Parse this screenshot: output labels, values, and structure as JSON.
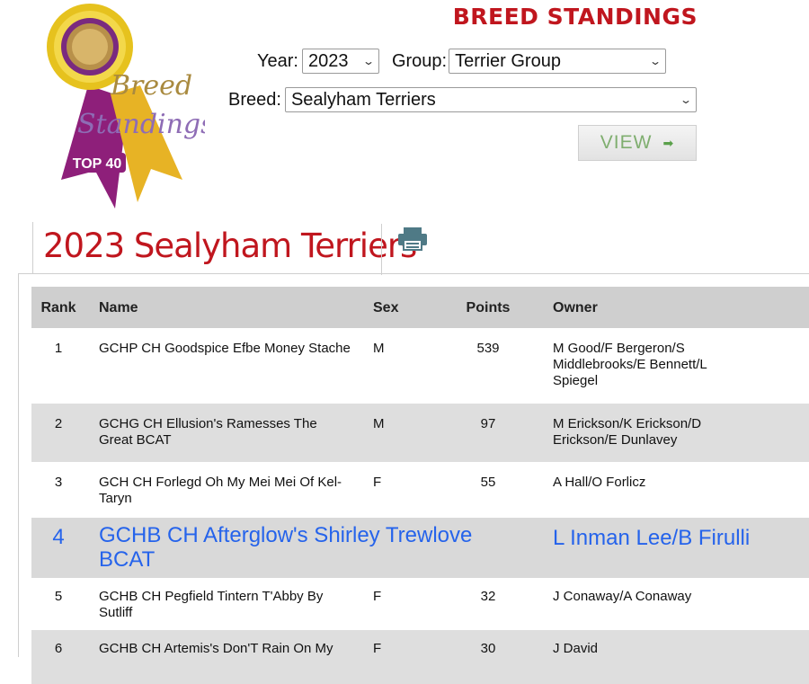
{
  "header": {
    "title": "BREED STANDINGS"
  },
  "logo": {
    "line1": "Breed",
    "line2": "Standings",
    "badge": "TOP 40"
  },
  "filters": {
    "year_label": "Year:",
    "year_value": "2023",
    "group_label": "Group:",
    "group_value": "Terrier Group",
    "breed_label": "Breed:",
    "breed_value": "Sealyham Terriers",
    "view_label": "VIEW"
  },
  "results": {
    "title": "2023 Sealyham Terriers"
  },
  "table": {
    "headers": {
      "rank": "Rank",
      "name": "Name",
      "sex": "Sex",
      "points": "Points",
      "owner": "Owner"
    },
    "rows": [
      {
        "rank": "1",
        "name": "GCHP CH Goodspice Efbe Money Stache",
        "sex": "M",
        "points": "539",
        "owner": "M Good/F Bergeron/S Middlebrooks/E Bennett/L Spiegel"
      },
      {
        "rank": "2",
        "name": "GCHG CH Ellusion's Ramesses The Great BCAT",
        "sex": "M",
        "points": "97",
        "owner": "M Erickson/K Erickson/D Erickson/E Dunlavey"
      },
      {
        "rank": "3",
        "name": "GCH CH Forlegd Oh My Mei Mei Of Kel-Taryn",
        "sex": "F",
        "points": "55",
        "owner": "A Hall/O Forlicz"
      },
      {
        "rank": "4",
        "name": "GCHB CH Afterglow's Shirley Trewlove BCAT",
        "sex": "",
        "points": "",
        "owner": "L Inman Lee/B Firulli"
      },
      {
        "rank": "5",
        "name": "GCHB CH Pegfield Tintern T'Abby By Sutliff",
        "sex": "F",
        "points": "32",
        "owner": "J Conaway/A Conaway"
      },
      {
        "rank": "6",
        "name": "GCHB CH Artemis's Don'T Rain On My",
        "sex": "F",
        "points": "30",
        "owner": "J David"
      }
    ]
  },
  "colors": {
    "brand_red": "#c0161e",
    "highlight_blue": "#2563eb",
    "view_green": "#5aa04a"
  }
}
